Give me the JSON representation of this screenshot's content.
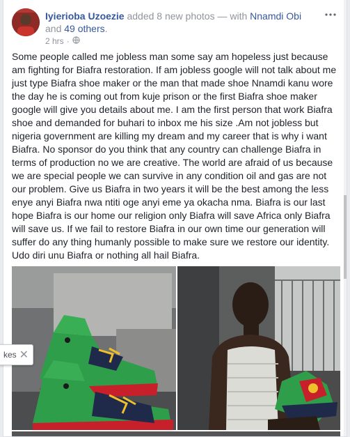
{
  "post": {
    "author": "Iyierioba Uzoezie",
    "action": " added 8 new photos — with ",
    "tagged": "Nnamdi Obi",
    "and": " and ",
    "others": "49 others",
    "period": ".",
    "time": "2 hrs",
    "privacy_icon": "globe-icon",
    "more_icon": "more-options-icon",
    "text": "Some people called me jobless man some say am hopeless just because am fighting for Biafra restoration. If am jobless google will not talk about me just type Biafra shoe maker or the man that made shoe Nnamdi kanu wore the day he is coming out from kuje prison or the first Biafra shoe maker google will give you details about me. I am the first person that work Biafra shoe and demanded for buhari to inbox me his size .Am not jobless but nigeria government are killing my dream and my career that is why i want Biafra. No sponsor do you think that any country can challenge Biafra in terms of production no we are creative. The world are afraid of us because we are special people we can survive in any condition oil and gas are not our problem. Give us Biafra in two years it will be the best among the less enye anyi Biafra nwa ntiti oge anyi eme ya okacha nma. Biafra is our last hope Biafra is our home our religion only Biafra will save Africa only Biafra will save us. If we fail to restore Biafra in our own time our generation will suffer do any thing humanly possible to make sure we restore our identity. Udo diri unu Biafra or nothing all hail Biafra."
  },
  "popup": {
    "text": "kes",
    "close_icon": "close-icon"
  },
  "colors": {
    "link": "#365899",
    "text": "#1d2129",
    "meta": "#90949c",
    "shoe_green": "#2f9e4a",
    "shoe_red": "#c8202a",
    "shoe_navy": "#1f2a4a"
  }
}
